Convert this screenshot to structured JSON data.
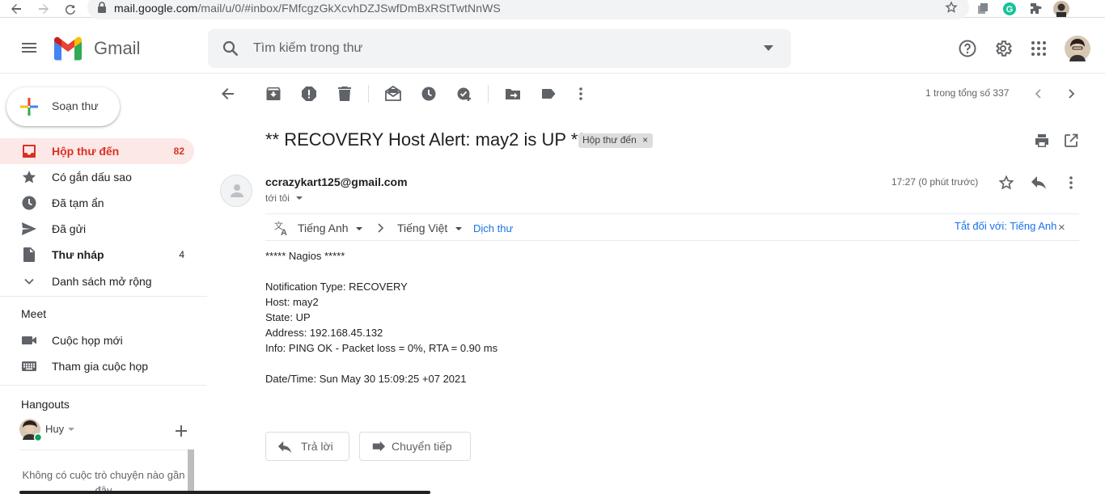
{
  "browser": {
    "url_domain": "mail.google.com",
    "url_path": "/mail/u/0/#inbox/FMfcgzGkXcvhDZJSwfDmBxRStTwtNnWS"
  },
  "app": {
    "name": "Gmail"
  },
  "search": {
    "placeholder": "Tìm kiếm trong thư"
  },
  "compose": {
    "label": "Soạn thư"
  },
  "nav": [
    {
      "label": "Hộp thư đến",
      "count": "82",
      "icon": "inbox-icon"
    },
    {
      "label": "Có gắn dấu sao",
      "count": "",
      "icon": "star-icon"
    },
    {
      "label": "Đã tạm ẩn",
      "count": "",
      "icon": "clock-icon"
    },
    {
      "label": "Đã gửi",
      "count": "",
      "icon": "send-icon"
    },
    {
      "label": "Thư nháp",
      "count": "4",
      "icon": "draft-icon"
    },
    {
      "label": "Danh sách mở rộng",
      "count": "",
      "icon": "chevron-down-icon"
    }
  ],
  "meet": {
    "title": "Meet",
    "items": [
      {
        "label": "Cuộc họp mới"
      },
      {
        "label": "Tham gia cuộc họp"
      }
    ]
  },
  "hangouts": {
    "title": "Hangouts",
    "user": "Huy",
    "empty_text_1": "Không có cuộc trò chuyện nào gần",
    "empty_text_2": "đây"
  },
  "pager": {
    "text": "1 trong tổng số 337"
  },
  "email": {
    "subject": "** RECOVERY Host Alert: may2 is UP **",
    "label_chip": "Hộp thư đến",
    "sender": "ccrazykart125@gmail.com",
    "to": "tới tôi",
    "time": "17:27 (0 phút trước)",
    "translate": {
      "from": "Tiếng Anh",
      "to": "Tiếng Việt",
      "action": "Dịch thư",
      "turn_off": "Tắt đối với: Tiếng Anh"
    },
    "body": [
      "***** Nagios *****",
      "",
      "Notification Type: RECOVERY",
      "Host: may2",
      "State: UP",
      "Address: 192.168.45.132",
      "Info: PING OK - Packet loss = 0%, RTA = 0.90 ms",
      "",
      "Date/Time: Sun May 30 15:09:25 +07 2021"
    ],
    "reply_label": "Trả lời",
    "forward_label": "Chuyển tiếp"
  },
  "colors": {
    "accent_red": "#d93025",
    "active_bg": "#fce8e6",
    "link_blue": "#1a73e8"
  }
}
